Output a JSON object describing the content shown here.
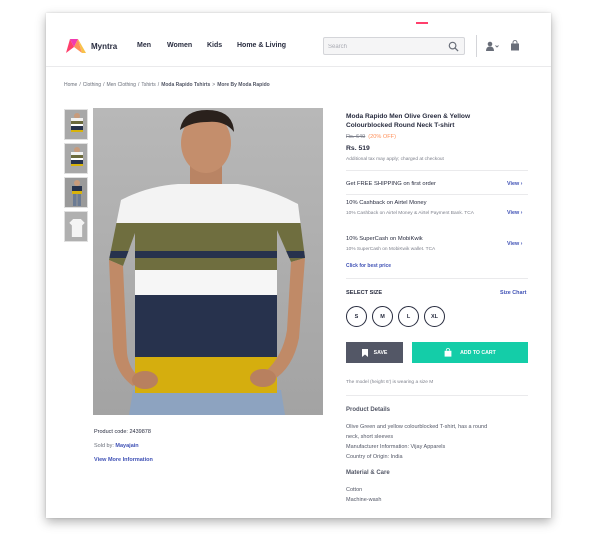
{
  "header": {
    "brand": "Myntra",
    "nav": [
      "Men",
      "Women",
      "Kids",
      "Home & Living"
    ],
    "search_placeholder": "Search"
  },
  "breadcrumb": [
    {
      "label": "Home",
      "strong": false
    },
    {
      "label": "Clothing",
      "strong": false
    },
    {
      "label": "Men Clothing",
      "strong": false
    },
    {
      "label": "Tshirts",
      "strong": false
    },
    {
      "label": "Moda Rapido Tshirts",
      "strong": true
    },
    {
      "label": "More By Moda Rapido",
      "strong": true
    }
  ],
  "breadcrumb_separator": "/",
  "breadcrumb_last_separator": ">",
  "thumbnails": [
    {
      "stripe_colors": [
        "#f2f2f2",
        "#6b6a3c",
        "#ffffff",
        "#26324c",
        "#d8b30b"
      ]
    },
    {
      "stripe_colors": [
        "#f2f2f2",
        "#6b6a3c",
        "#ffffff",
        "#26324c",
        "#d8b30b"
      ]
    },
    {
      "stripe_colors": [
        "#26324c",
        "#d8b30b",
        "#26324c",
        "#6b7b94",
        "#6b7b94"
      ]
    },
    {
      "stripe_colors": [
        "#f2f2f2",
        "#f2f2f2",
        "#f2f2f2",
        "#f2f2f2",
        "#f2f2f2"
      ]
    }
  ],
  "product": {
    "code_text": "Product code: 2439878",
    "sold_by_label": "Sold by:",
    "sold_by_value": "Mayajain",
    "view_more": "View More Information",
    "title": "Moda Rapido Men Olive Green & Yellow Colourblocked Round Neck T-shirt",
    "mrp": "Rs. 649",
    "discount": "(20% OFF)",
    "price": "Rs. 519",
    "tax_note": "Additional tax may apply; charged at checkout",
    "free_shipping": "Get FREE SHIPPING on first order",
    "offers": [
      {
        "title": "10% Cashback on Airtel Money",
        "sub": "10% Cashback on Airtel Money & Airtel Payment Bank. TCA"
      },
      {
        "title": "10% SuperCash on MobiKwik",
        "sub": "10% SuperCash on MobiKwik wallet. TCA"
      }
    ],
    "view_label": "View",
    "best_price": "Click for best price",
    "select_size": "SELECT SIZE",
    "size_chart": "Size Chart",
    "sizes": [
      "S",
      "M",
      "L",
      "XL"
    ],
    "save_label": "SAVE",
    "add_to_cart_label": "ADD TO CART",
    "model_note": "The model (height 6') is wearing a size M",
    "details_heading": "Product Details",
    "details_lines": [
      "Olive Green and yellow colourblocked T-shirt, has a round",
      "neck, short sleeves",
      "Manufacturer Information: Vijay Apparels",
      "Country of Origin: India"
    ],
    "material_heading": "Material & Care",
    "material_lines": [
      "Cotton",
      "Machine-wash"
    ]
  },
  "colors": {
    "accent_pink": "#ff3f6c",
    "link_blue": "#3f51b5",
    "cart_green": "#14cda8",
    "save_gray": "#535766",
    "discount_orange": "#ff905a"
  }
}
